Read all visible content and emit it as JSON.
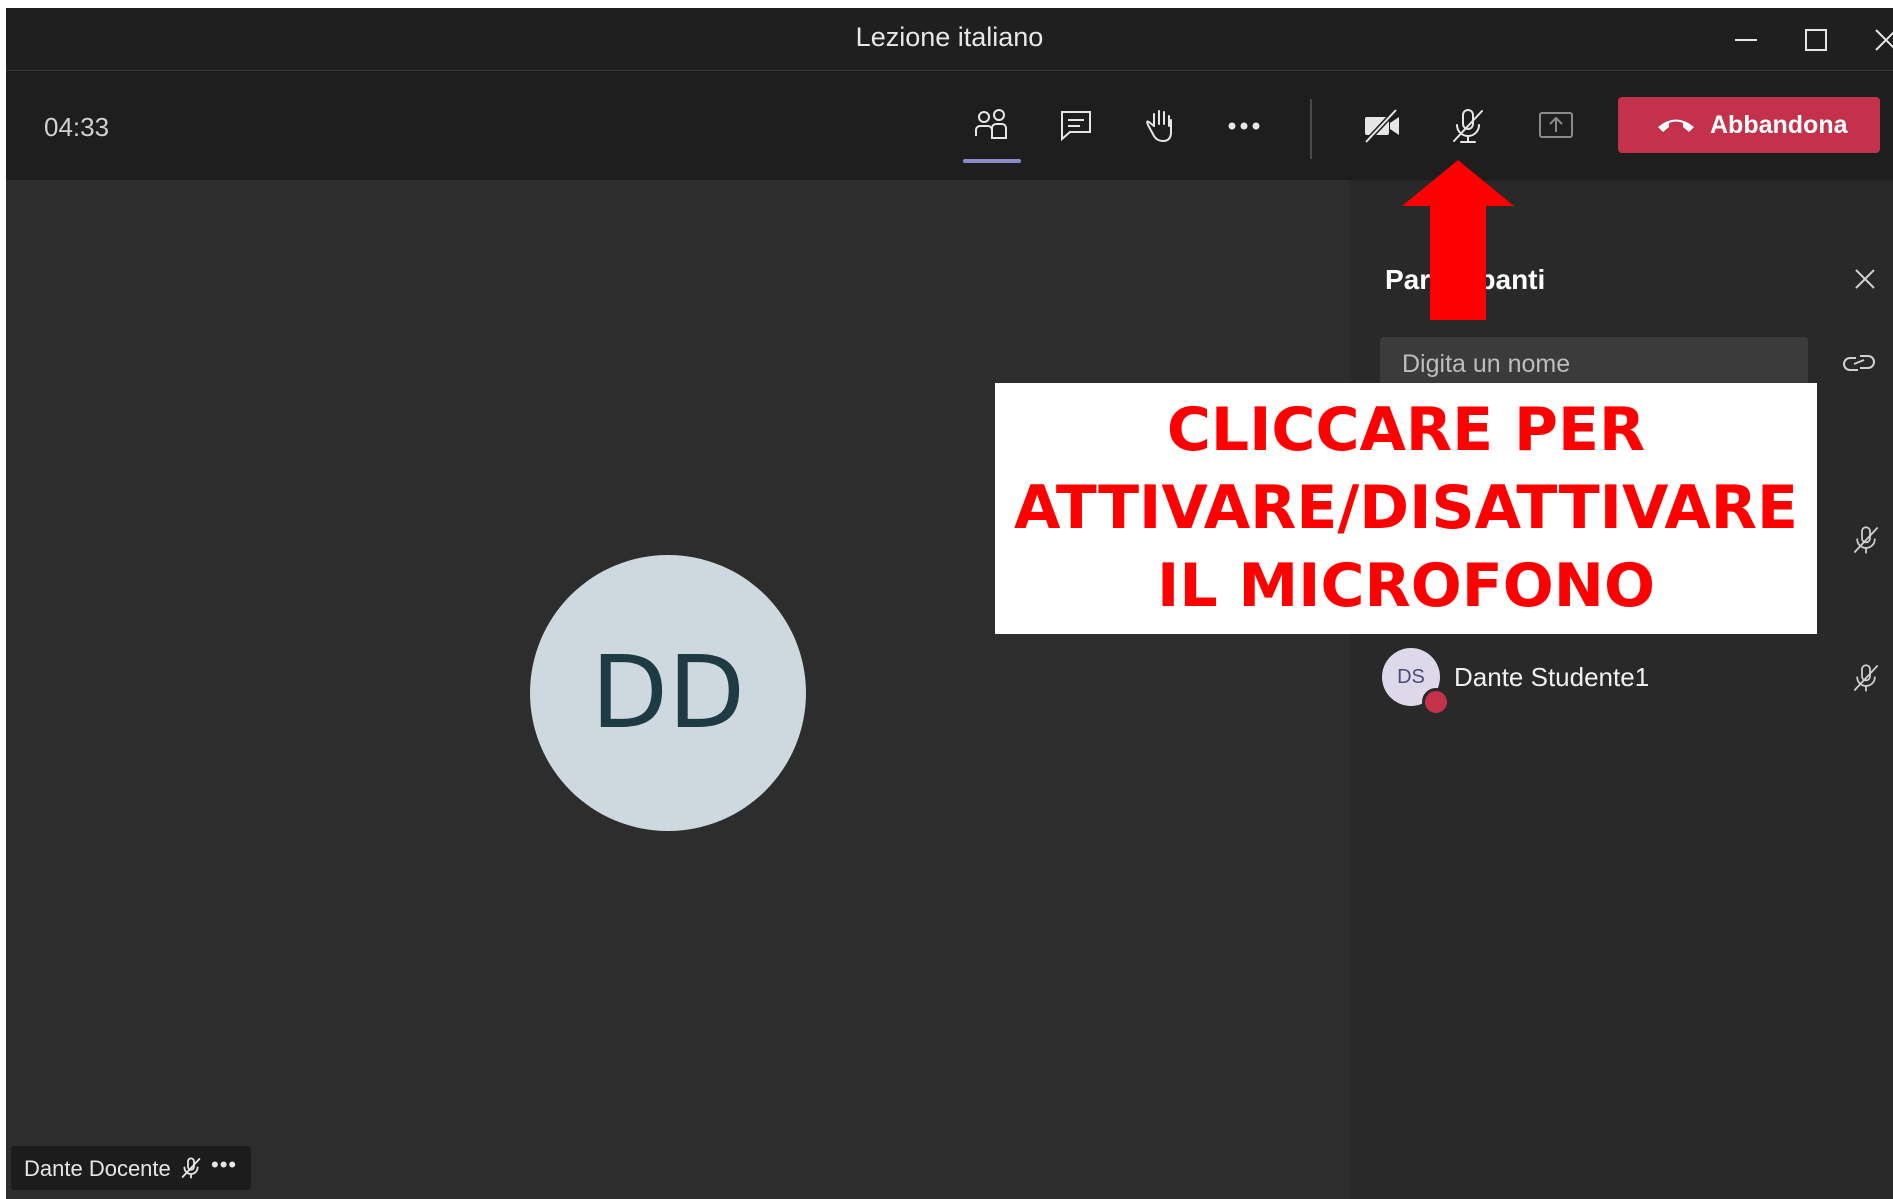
{
  "window": {
    "title": "Lezione italiano",
    "controls": [
      "minimize-icon",
      "maximize-icon",
      "close-icon"
    ]
  },
  "toolbar": {
    "timer": "04:33",
    "buttons": [
      "participants-icon",
      "chat-icon",
      "raise-hand-icon",
      "more-options-icon",
      "camera-off-icon",
      "mic-off-icon",
      "share-screen-icon"
    ],
    "leave_label": "Abbandona",
    "leave_color": "#c4314b",
    "active_indicator_color": "#8b8cc7"
  },
  "stage": {
    "avatar_initials": "DD",
    "presenter_name": "Dante Docente",
    "presenter_more": "•••"
  },
  "panel": {
    "title": "Partecipanti",
    "search_placeholder": "Digita un nome",
    "participants": [
      {
        "initials": "DS",
        "name": "Dante Studente1",
        "status_color": "#c4314b",
        "muted": true
      }
    ]
  },
  "annotation": {
    "line1": "CLICCARE PER",
    "line2": "ATTIVARE/DISATTIVARE",
    "line3": "IL MICROFONO",
    "color": "#ff0000"
  }
}
